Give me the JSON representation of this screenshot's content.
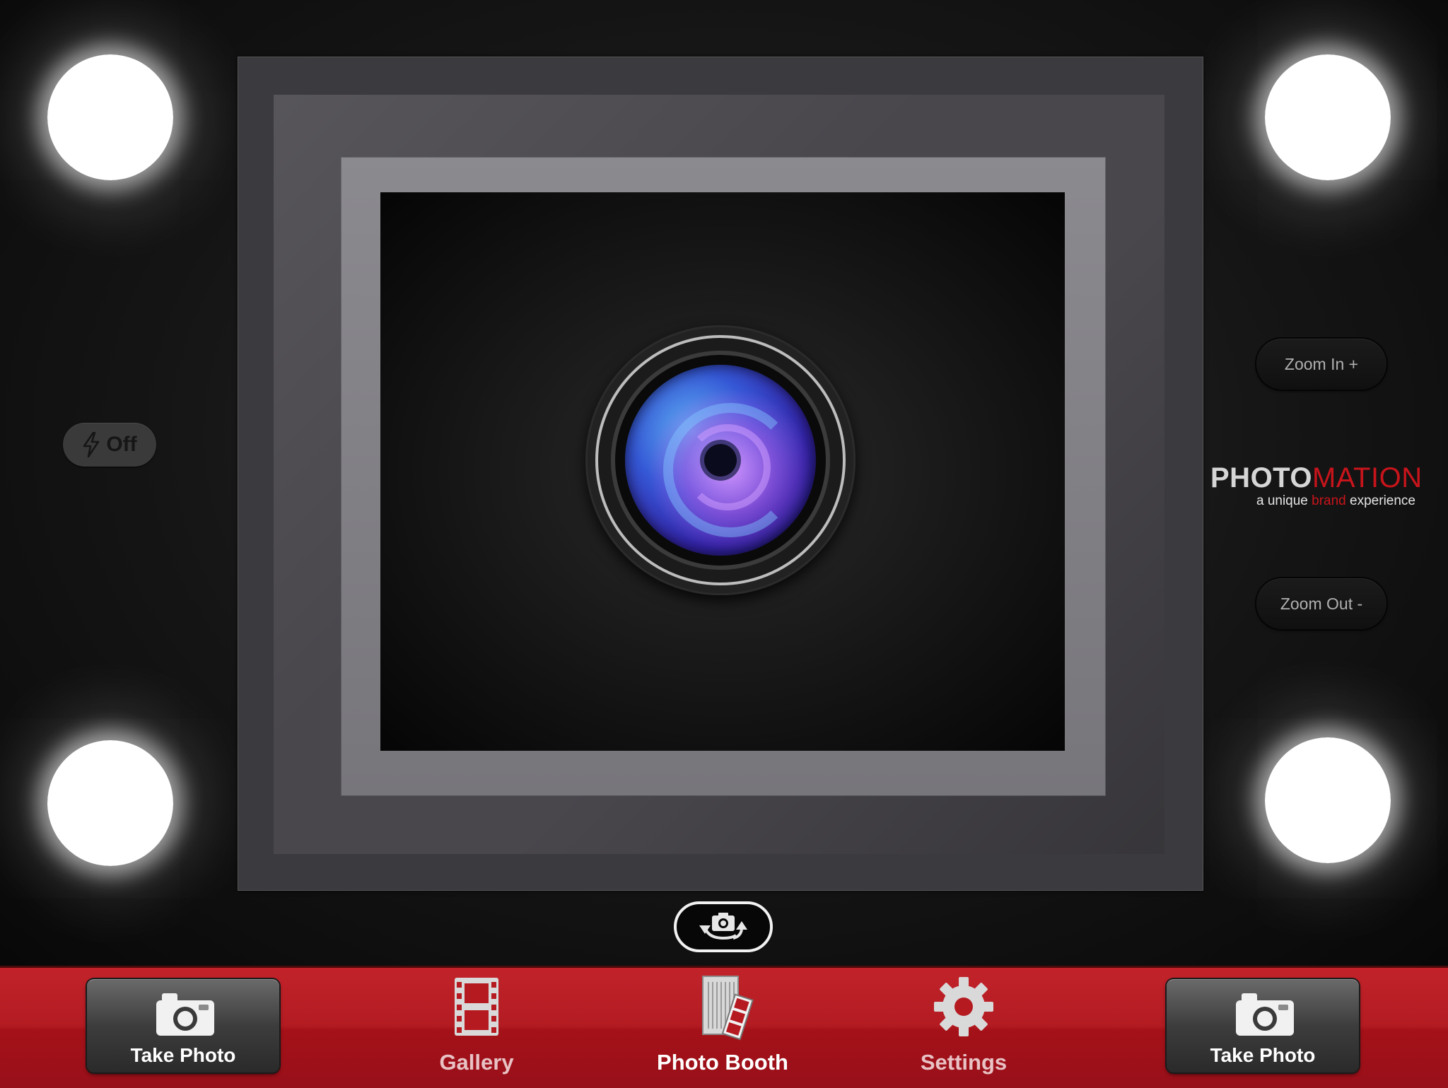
{
  "flash": {
    "label": "Off",
    "icon": "lightning-icon"
  },
  "zoom": {
    "in_label": "Zoom In +",
    "out_label": "Zoom Out -"
  },
  "logo": {
    "word_part1": "PHOTO",
    "word_part2": "MATION",
    "tagline_pre": "a unique",
    "tagline_brand": "brand",
    "tagline_post": "experience"
  },
  "switch_camera": {
    "icon": "camera-switch-icon"
  },
  "toolbar": {
    "take_photo_left": "Take Photo",
    "take_photo_right": "Take Photo",
    "tabs": [
      {
        "label": "Gallery",
        "icon": "film-strip-icon",
        "active": false
      },
      {
        "label": "Photo Booth",
        "icon": "photo-booth-icon",
        "active": true
      },
      {
        "label": "Settings",
        "icon": "gear-icon",
        "active": false
      }
    ]
  },
  "colors": {
    "toolbar_red": "#b31b22",
    "brand_red": "#c8141b",
    "light_white": "#ffffff"
  }
}
